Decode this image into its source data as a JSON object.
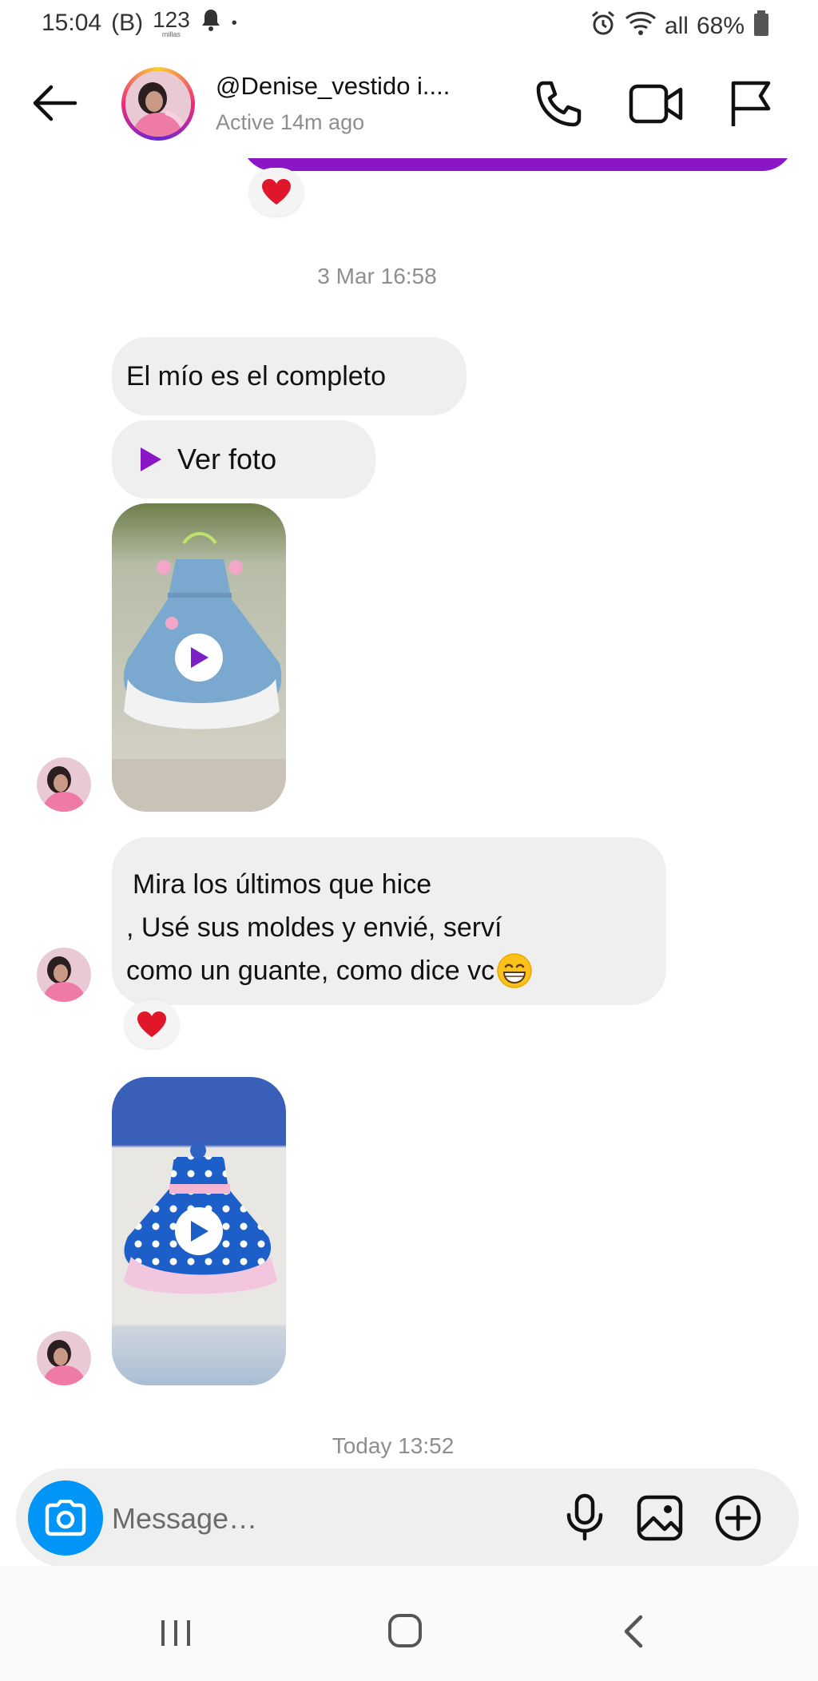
{
  "status_bar": {
    "time": "15:04",
    "carrier": "(B)",
    "count": "123",
    "count_sub": "millas",
    "dot": "•",
    "network": "all",
    "battery": "68%"
  },
  "header": {
    "username": "@Denise_vestido i....",
    "status": "Active 14m ago"
  },
  "messages": {
    "timestamp_1": "3 Mar 16:58",
    "text_1": "El mío es el completo",
    "view_photo": "Ver foto",
    "text_2_line_1": "Mira los últimos que hice",
    "text_2_line_2": ", Usé sus moldes y envié, serví",
    "text_2_line_3": "como un guante, como dice vc",
    "timestamp_2": "Today 13:52"
  },
  "composer": {
    "placeholder": "Message…"
  },
  "colors": {
    "accent_purple": "#8a16c8",
    "camera_blue": "#0095f6",
    "heart_red": "#e0162b",
    "bubble_gray": "#efefef"
  }
}
